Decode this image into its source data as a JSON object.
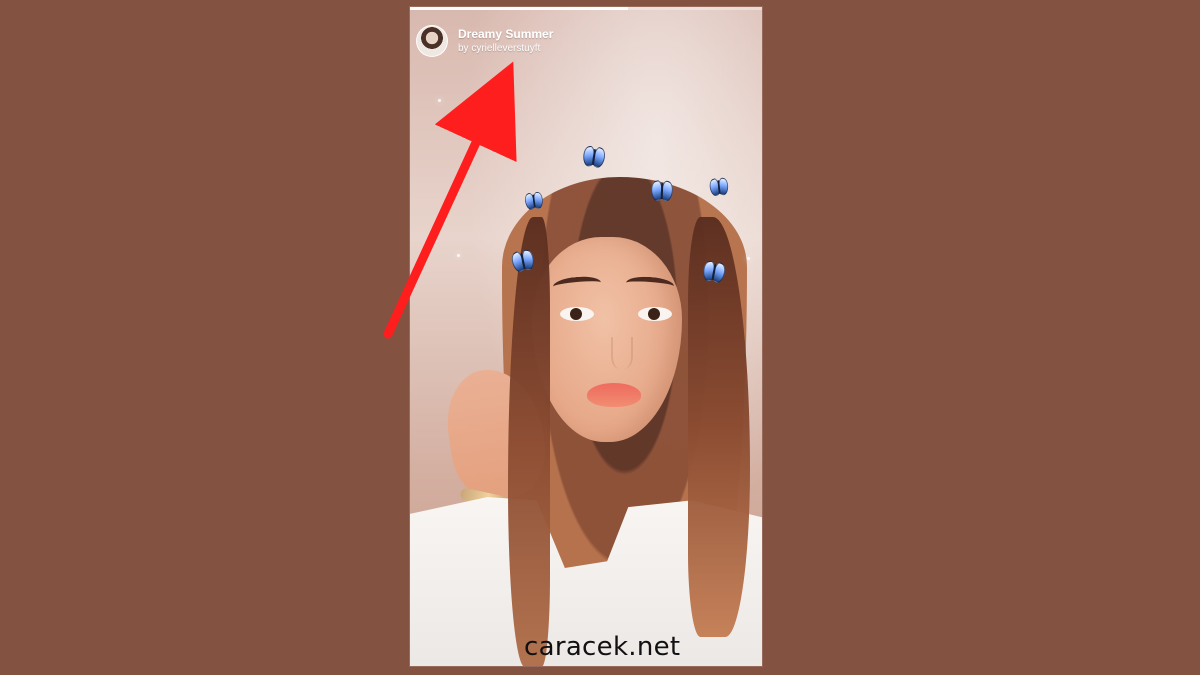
{
  "story": {
    "progress": 0.62,
    "effect_title": "Dreamy Summer",
    "effect_author": "by cyrielleverstuyft"
  },
  "watermark": {
    "text": "caracek.net"
  },
  "annotation": {
    "arrow_color": "#ff1e1e"
  },
  "colors": {
    "background": "#845240",
    "accent_ui": "#ffffff"
  },
  "icons": {
    "avatar": "profile-avatar",
    "butterfly": "butterfly-icon",
    "sparkle": "sparkle-icon"
  }
}
